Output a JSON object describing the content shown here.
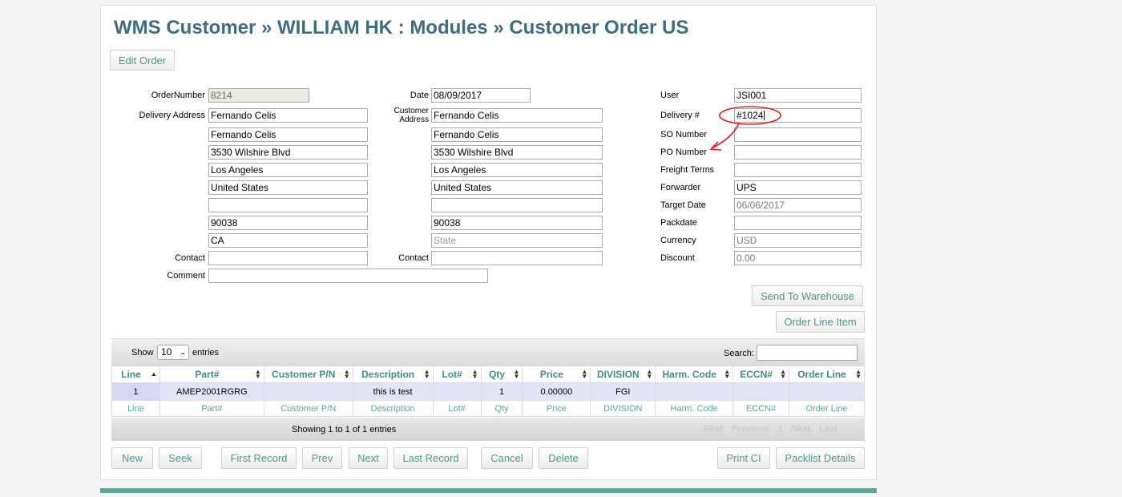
{
  "header": {
    "title": "WMS Customer » WILLIAM HK : Modules » Customer Order US"
  },
  "edit_button": "Edit Order",
  "left": {
    "order_number_label": "OrderNumber",
    "order_number": "8214",
    "delivery_address_label": "Delivery Address",
    "delivery_lines": [
      "Fernando Celis",
      "Fernando Celis",
      "3530 Wilshire Blvd",
      "Los Angeles",
      "United States",
      "",
      "90038",
      "CA"
    ],
    "contact_label": "Contact",
    "contact": "",
    "comment_label": "Comment",
    "comment": ""
  },
  "middle": {
    "date_label": "Date",
    "date": "08/09/2017",
    "customer_address_label_1": "Customer",
    "customer_address_label_2": "Address",
    "customer_lines": [
      "Fernando Celis",
      "Fernando Celis",
      "3530 Wilshire Blvd",
      "Los Angeles",
      "United States",
      "",
      "90038"
    ],
    "state_placeholder": "State",
    "contact_label": "Contact",
    "contact": ""
  },
  "right": {
    "user_label": "User",
    "user": "JSI001",
    "delivery_label": "Delivery #",
    "delivery": "#1024",
    "so_label": "SO Number",
    "so": "",
    "po_label": "PO Number",
    "po": "",
    "freight_label": "Freight Terms",
    "freight": "",
    "forwarder_label": "Forwarder",
    "forwarder": "UPS",
    "target_label": "Target Date",
    "target": "06/06/2017",
    "packdate_label": "Packdate",
    "packdate": "",
    "currency_label": "Currency",
    "currency": "USD",
    "discount_label": "Discount",
    "discount": "0.00"
  },
  "send_button": "Send To Warehouse",
  "orderline_button": "Order Line Item",
  "table": {
    "show_label": "Show",
    "entries_value": "10",
    "entries_label": "entries",
    "search_label": "Search:",
    "columns": [
      "Line",
      "Part#",
      "Customer P/N",
      "Description",
      "Lot#",
      "Qty",
      "Price",
      "DIVISION",
      "Harm. Code",
      "ECCN#",
      "Order Line"
    ],
    "rows": [
      [
        "1",
        "AMEP2001RGRG",
        "",
        "this is test",
        "",
        "1",
        "0.00000",
        "FGI",
        "",
        "",
        ""
      ]
    ],
    "footer": [
      "Line",
      "Part#",
      "Customer P/N",
      "Description",
      "Lot#",
      "Qty",
      "Price",
      "DIVISION",
      "Harm. Code",
      "ECCN#",
      "Order Line"
    ],
    "info": "Showing 1 to 1 of 1 entries",
    "pager": {
      "first": "First",
      "previous": "Previous",
      "page": "1",
      "next": "Next",
      "last": "Last"
    }
  },
  "actions": {
    "new": "New",
    "seek": "Seek",
    "first": "First Record",
    "prev": "Prev",
    "next": "Next",
    "last": "Last Record",
    "cancel": "Cancel",
    "delete": "Delete",
    "print": "Print CI",
    "packlist": "Packlist Details"
  },
  "colors": {
    "title": "#3d6e80",
    "accent": "#5aa69c",
    "annotation": "#e8191d"
  }
}
